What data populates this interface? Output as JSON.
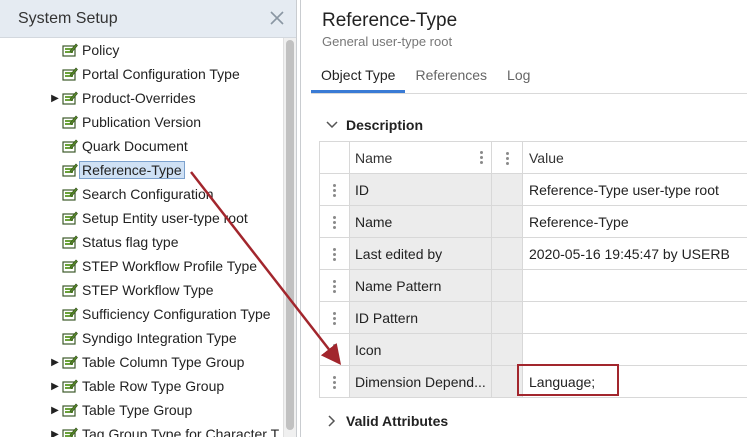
{
  "left_panel": {
    "title": "System Setup",
    "tree_items": [
      {
        "label": "Policy",
        "expandable": false
      },
      {
        "label": "Portal Configuration Type",
        "expandable": false
      },
      {
        "label": "Product-Overrides",
        "expandable": true
      },
      {
        "label": "Publication Version",
        "expandable": false
      },
      {
        "label": "Quark Document",
        "expandable": false
      },
      {
        "label": "Reference-Type",
        "expandable": false,
        "selected": true
      },
      {
        "label": "Search Configuration",
        "expandable": false
      },
      {
        "label": "Setup Entity user-type root",
        "expandable": false
      },
      {
        "label": "Status flag type",
        "expandable": false
      },
      {
        "label": "STEP Workflow Profile Type",
        "expandable": false
      },
      {
        "label": "STEP Workflow Type",
        "expandable": false
      },
      {
        "label": "Sufficiency Configuration Type",
        "expandable": false
      },
      {
        "label": "Syndigo Integration Type",
        "expandable": false
      },
      {
        "label": "Table Column Type Group",
        "expandable": true
      },
      {
        "label": "Table Row Type Group",
        "expandable": true
      },
      {
        "label": "Table Type Group",
        "expandable": true
      },
      {
        "label": "Tag Group Type for Character T",
        "expandable": true
      }
    ]
  },
  "right_panel": {
    "title": "Reference-Type",
    "subtitle": "General user-type root",
    "tabs": [
      "Object Type",
      "References",
      "Log"
    ],
    "active_tab": "Object Type",
    "description_label": "Description",
    "valid_attributes_label": "Valid Attributes",
    "table": {
      "headers": {
        "name": "Name",
        "value": "Value"
      },
      "rows": [
        {
          "name": "ID",
          "value": "Reference-Type user-type root"
        },
        {
          "name": "Name",
          "value": "Reference-Type"
        },
        {
          "name": "Last edited by",
          "value": "2020-05-16 19:45:47 by USERB"
        },
        {
          "name": "Name Pattern",
          "value": ""
        },
        {
          "name": "ID Pattern",
          "value": ""
        },
        {
          "name": "Icon",
          "value": ""
        },
        {
          "name": "Dimension Depend...",
          "value": "Language;"
        }
      ]
    }
  },
  "colors": {
    "annotation": "#a2262d",
    "tab_accent": "#3a7bd5",
    "header_bg": "#e5ebf2"
  }
}
